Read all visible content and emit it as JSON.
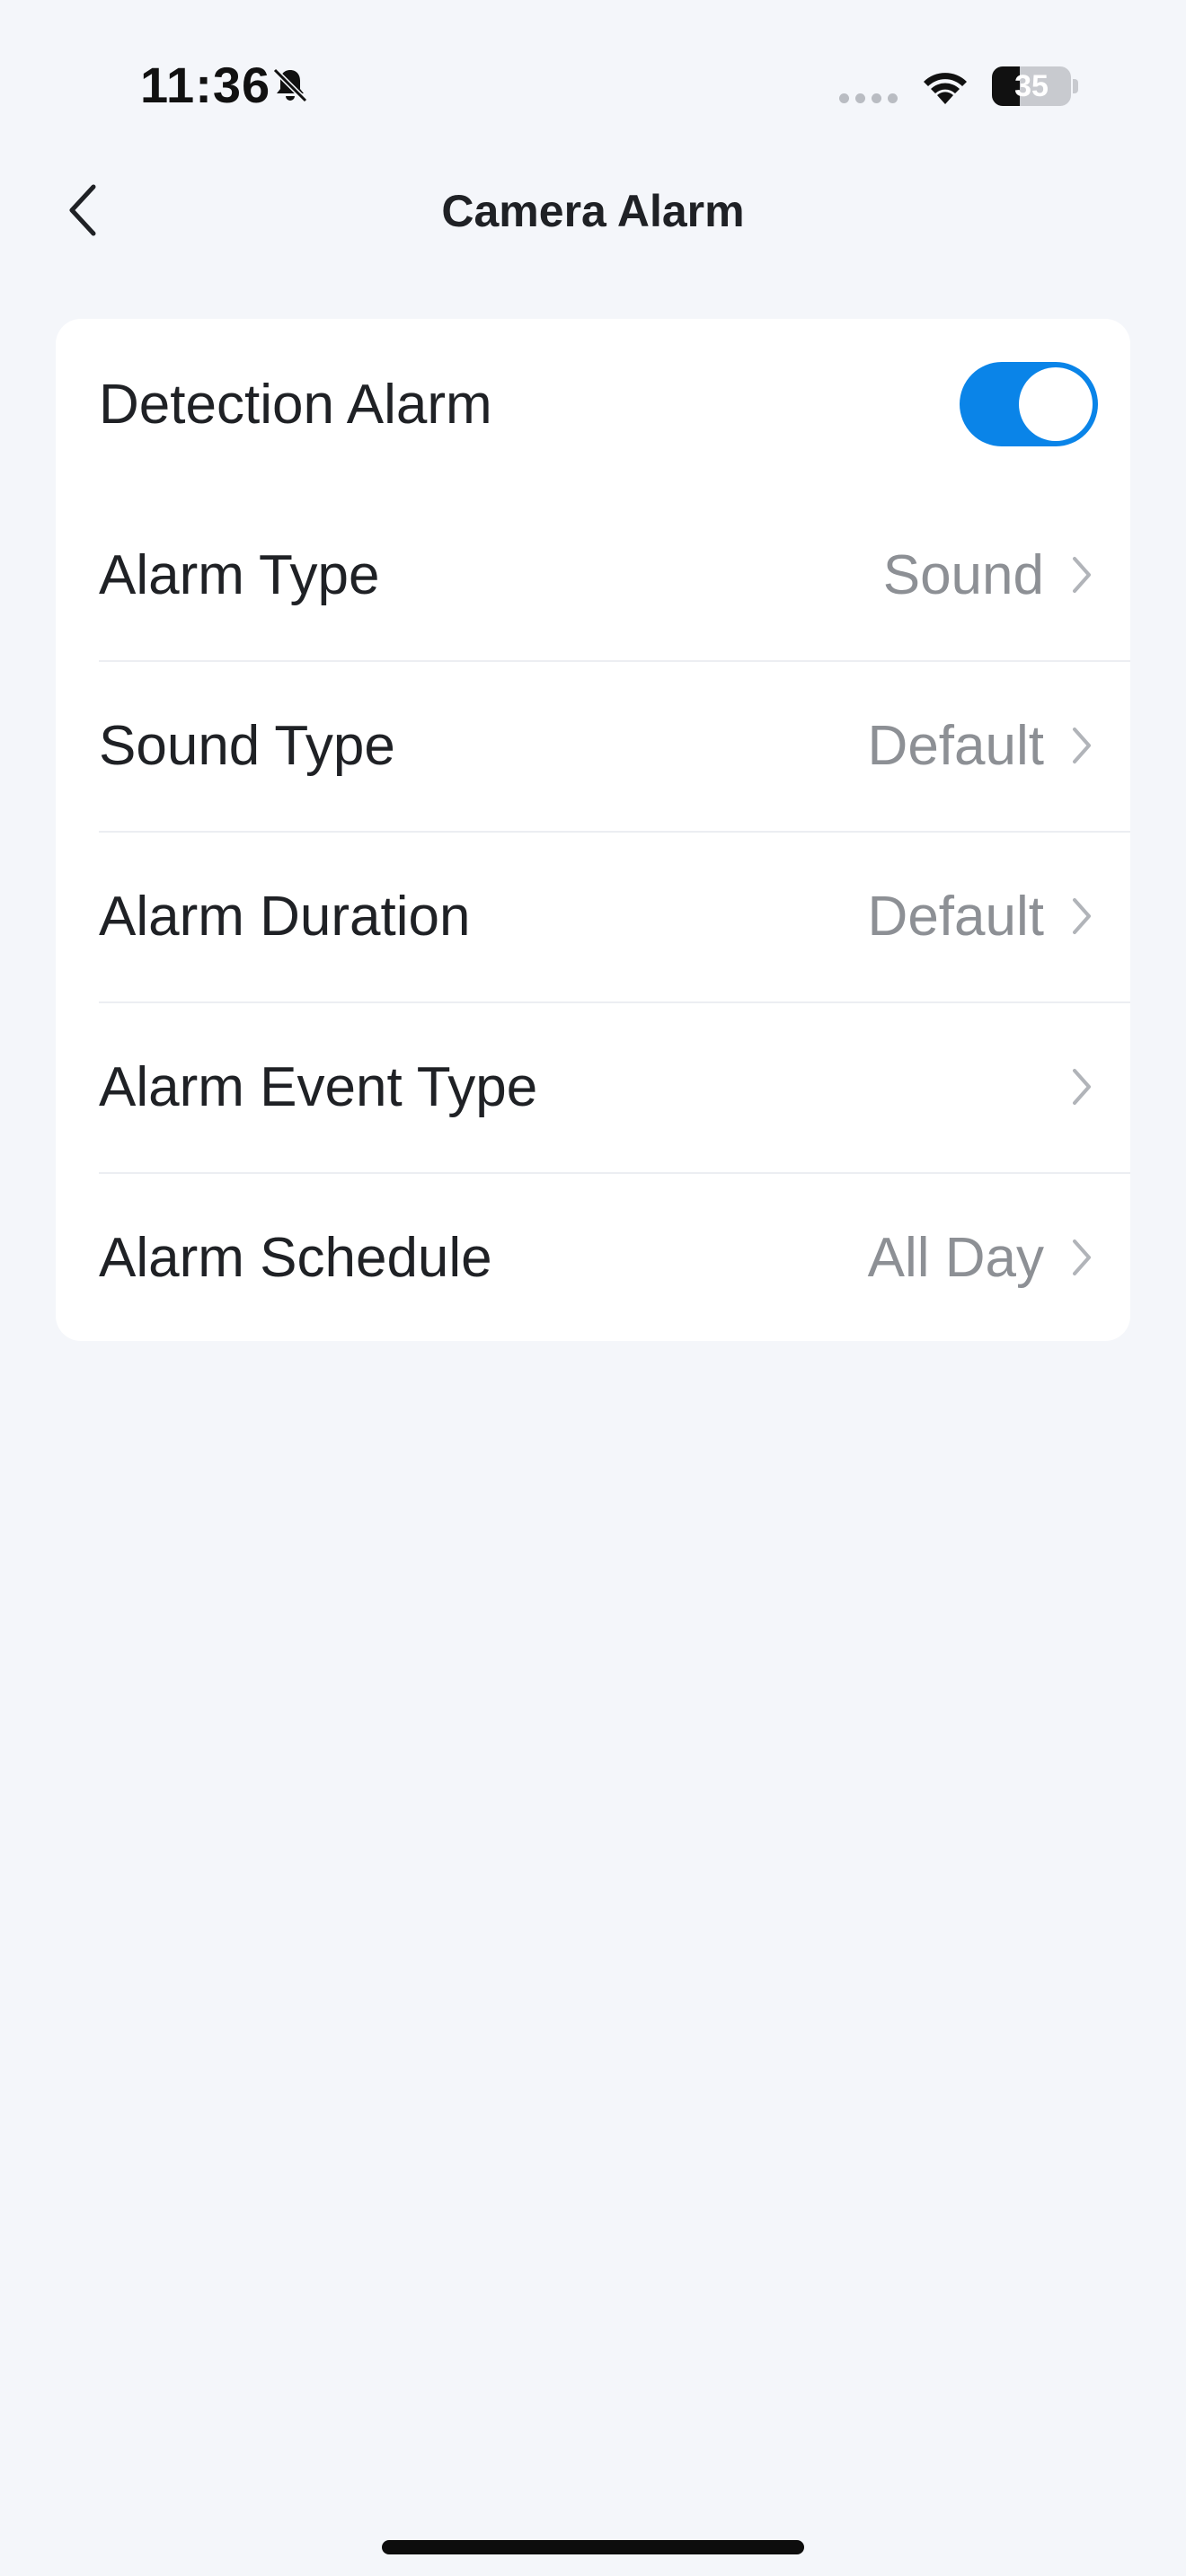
{
  "status_bar": {
    "time": "11:36",
    "battery_level": "35",
    "battery_fraction": 0.35,
    "icons": [
      "bell-slash-icon",
      "signal-dots-icon",
      "wifi-icon",
      "battery-icon"
    ]
  },
  "nav": {
    "title": "Camera Alarm",
    "back_icon": "chevron-left-icon"
  },
  "settings": {
    "detection_alarm": {
      "label": "Detection Alarm",
      "enabled": true,
      "toggle_color": "#0a84e8"
    },
    "rows": [
      {
        "label": "Alarm Type",
        "value": "Sound"
      },
      {
        "label": "Sound Type",
        "value": "Default"
      },
      {
        "label": "Alarm Duration",
        "value": "Default"
      },
      {
        "label": "Alarm Event Type",
        "value": ""
      },
      {
        "label": "Alarm Schedule",
        "value": "All Day"
      }
    ]
  },
  "colors": {
    "background": "#f4f6fa",
    "card": "#ffffff",
    "accent": "#0a84e8",
    "secondary_text": "#8d9095"
  }
}
